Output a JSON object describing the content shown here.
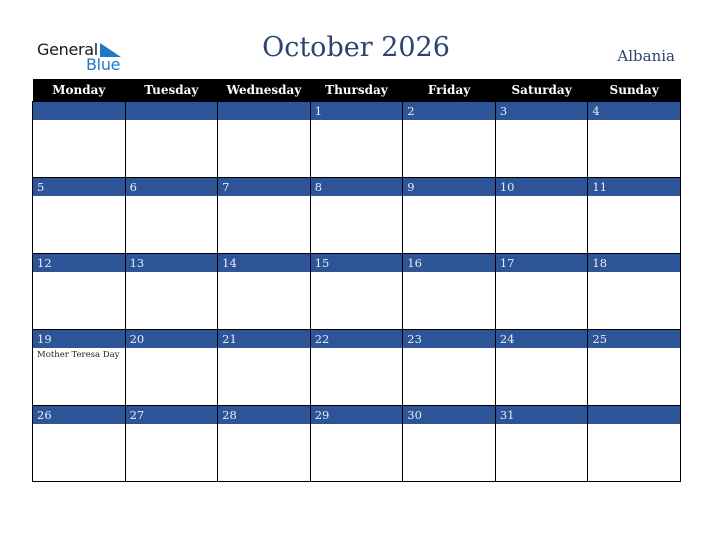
{
  "logo": {
    "word1": "General",
    "word2": "Blue"
  },
  "header": {
    "title": "October 2026",
    "country": "Albania"
  },
  "weekdays": [
    "Monday",
    "Tuesday",
    "Wednesday",
    "Thursday",
    "Friday",
    "Saturday",
    "Sunday"
  ],
  "weeks": [
    [
      {
        "day": ""
      },
      {
        "day": ""
      },
      {
        "day": ""
      },
      {
        "day": "1"
      },
      {
        "day": "2"
      },
      {
        "day": "3"
      },
      {
        "day": "4"
      }
    ],
    [
      {
        "day": "5"
      },
      {
        "day": "6"
      },
      {
        "day": "7"
      },
      {
        "day": "8"
      },
      {
        "day": "9"
      },
      {
        "day": "10"
      },
      {
        "day": "11"
      }
    ],
    [
      {
        "day": "12"
      },
      {
        "day": "13"
      },
      {
        "day": "14"
      },
      {
        "day": "15"
      },
      {
        "day": "16"
      },
      {
        "day": "17"
      },
      {
        "day": "18"
      }
    ],
    [
      {
        "day": "19",
        "event": "Mother Teresa Day"
      },
      {
        "day": "20"
      },
      {
        "day": "21"
      },
      {
        "day": "22"
      },
      {
        "day": "23"
      },
      {
        "day": "24"
      },
      {
        "day": "25"
      }
    ],
    [
      {
        "day": "26"
      },
      {
        "day": "27"
      },
      {
        "day": "28"
      },
      {
        "day": "29"
      },
      {
        "day": "30"
      },
      {
        "day": "31"
      },
      {
        "day": ""
      }
    ]
  ],
  "colors": {
    "accent": "#2d5496",
    "header_bg": "#000000",
    "title": "#2b4470",
    "logo_blue": "#1f78c8"
  }
}
